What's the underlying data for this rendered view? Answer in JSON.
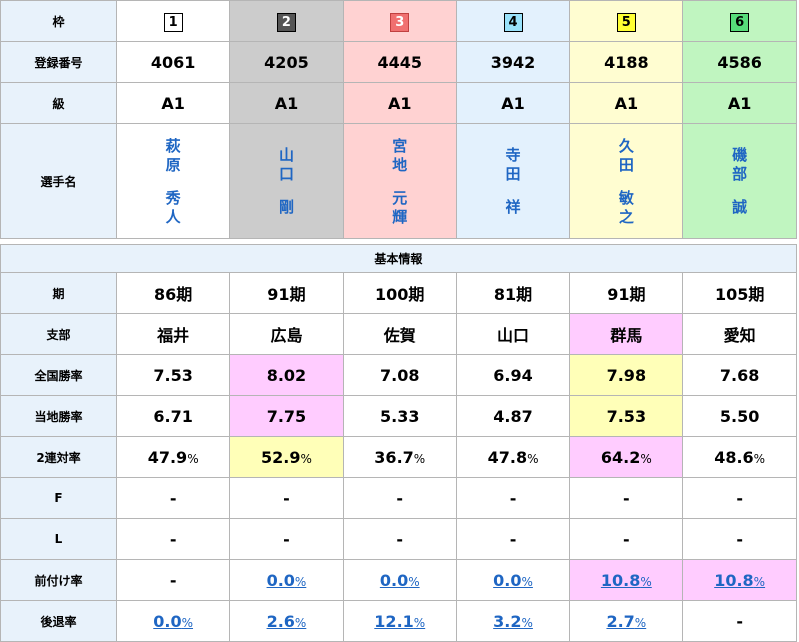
{
  "labels": {
    "waku": "枠",
    "toban": "登録番号",
    "kyu": "級",
    "senshu": "選手名",
    "section": "基本情報",
    "ki": "期",
    "shibu": "支部",
    "zenkoku": "全国勝率",
    "touchi": "当地勝率",
    "renritsu": "2連対率",
    "f": "F",
    "l": "L",
    "maezuke": "前付け率",
    "kotai": "後退率"
  },
  "colors": {
    "frame": [
      "#ffffff",
      "#cccccc",
      "#ffd2d2",
      "#e3f1fd",
      "#fffdd1",
      "#c0f5c0"
    ],
    "highlight_pink": "#ffccff",
    "highlight_yellow": "#ffffb8",
    "link": "#1f66c3"
  },
  "racers": [
    {
      "waku": "1",
      "toban": "4061",
      "kyu": "A1",
      "sei": [
        "萩",
        "原"
      ],
      "mei": [
        "秀",
        "人"
      ],
      "ki": "86期",
      "shibu": "福井",
      "zenkoku": "7.53",
      "touchi": "6.71",
      "renritsu": "47.9",
      "f": "-",
      "l": "-",
      "maezuke": "-",
      "kotai": "0.0"
    },
    {
      "waku": "2",
      "toban": "4205",
      "kyu": "A1",
      "sei": [
        "山",
        "口"
      ],
      "mei": [
        "剛"
      ],
      "ki": "91期",
      "shibu": "広島",
      "zenkoku": "8.02",
      "touchi": "7.75",
      "renritsu": "52.9",
      "f": "-",
      "l": "-",
      "maezuke": "0.0",
      "kotai": "2.6"
    },
    {
      "waku": "3",
      "toban": "4445",
      "kyu": "A1",
      "sei": [
        "宮",
        "地"
      ],
      "mei": [
        "元",
        "輝"
      ],
      "ki": "100期",
      "shibu": "佐賀",
      "zenkoku": "7.08",
      "touchi": "5.33",
      "renritsu": "36.7",
      "f": "-",
      "l": "-",
      "maezuke": "0.0",
      "kotai": "12.1"
    },
    {
      "waku": "4",
      "toban": "3942",
      "kyu": "A1",
      "sei": [
        "寺",
        "田"
      ],
      "mei": [
        "祥"
      ],
      "ki": "81期",
      "shibu": "山口",
      "zenkoku": "6.94",
      "touchi": "4.87",
      "renritsu": "47.8",
      "f": "-",
      "l": "-",
      "maezuke": "0.0",
      "kotai": "3.2"
    },
    {
      "waku": "5",
      "toban": "4188",
      "kyu": "A1",
      "sei": [
        "久",
        "田"
      ],
      "mei": [
        "敏",
        "之"
      ],
      "ki": "91期",
      "shibu": "群馬",
      "zenkoku": "7.98",
      "touchi": "7.53",
      "renritsu": "64.2",
      "f": "-",
      "l": "-",
      "maezuke": "10.8",
      "kotai": "2.7"
    },
    {
      "waku": "6",
      "toban": "4586",
      "kyu": "A1",
      "sei": [
        "磯",
        "部"
      ],
      "mei": [
        "誠"
      ],
      "ki": "105期",
      "shibu": "愛知",
      "zenkoku": "7.68",
      "touchi": "5.50",
      "renritsu": "48.6",
      "f": "-",
      "l": "-",
      "maezuke": "10.8",
      "kotai": "-"
    }
  ],
  "pct_unit": "%"
}
